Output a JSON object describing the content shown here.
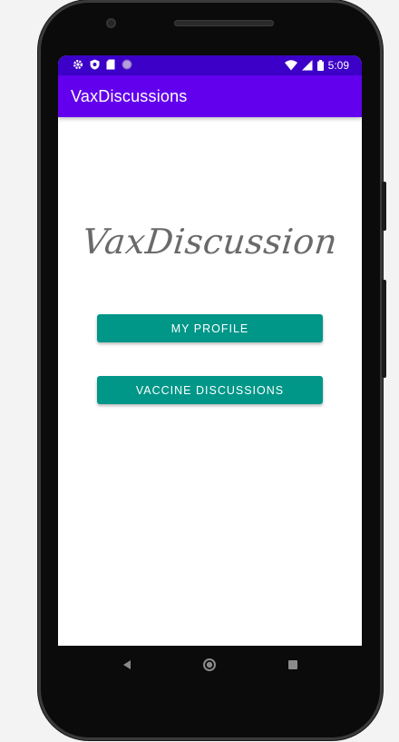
{
  "status_bar": {
    "time": "5:09",
    "icons_left": [
      "gear-icon",
      "shield-icon",
      "sd-card-icon",
      "circle-icon"
    ],
    "icons_right": [
      "wifi-icon",
      "signal-icon",
      "battery-icon"
    ]
  },
  "app_bar": {
    "title": "VaxDiscussions"
  },
  "main": {
    "logo_text": "VaxDiscussion",
    "my_profile_label": "MY PROFILE",
    "vaccine_discussions_label": "VACCINE DISCUSSIONS"
  },
  "nav_bar": {
    "icons": [
      "back-icon",
      "home-icon",
      "recents-icon"
    ]
  },
  "colors": {
    "status_bar": "#3c00c8",
    "app_bar": "#6200ee",
    "button": "#009688",
    "logo_text": "#6a6a6a"
  }
}
